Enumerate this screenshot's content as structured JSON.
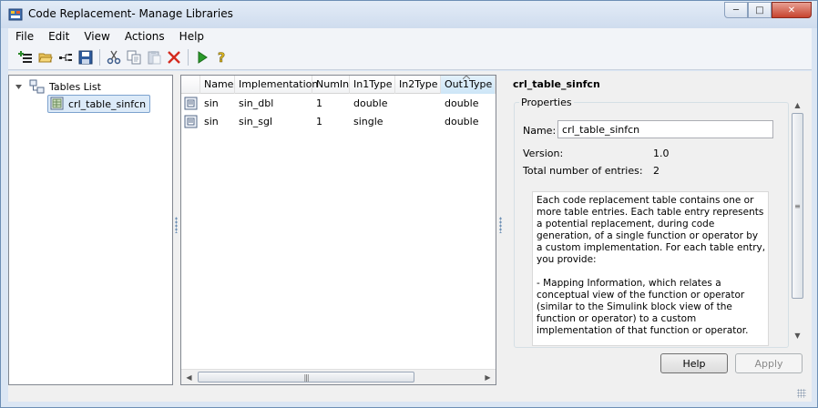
{
  "window": {
    "title": "Code Replacement- Manage Libraries"
  },
  "menu": [
    "File",
    "Edit",
    "View",
    "Actions",
    "Help"
  ],
  "toolbar": {
    "icons": [
      "new-table-icon",
      "open-folder-icon",
      "new-entry-icon",
      "save-icon",
      "cut-icon",
      "copy-icon",
      "paste-icon",
      "delete-icon",
      "validate-run-icon",
      "help-icon"
    ]
  },
  "tree": {
    "root_label": "Tables List",
    "child_label": "crl_table_sinfcn"
  },
  "table": {
    "columns": [
      "Name",
      "Implementation",
      "NumIn",
      "In1Type",
      "In2Type",
      "Out1Type"
    ],
    "rows": [
      [
        "sin",
        "sin_dbl",
        "1",
        "double",
        "",
        "double"
      ],
      [
        "sin",
        "sin_sgl",
        "1",
        "single",
        "",
        "double"
      ]
    ]
  },
  "details": {
    "title": "crl_table_sinfcn",
    "group_label": "Properties",
    "name_label": "Name:",
    "name_value": "crl_table_sinfcn",
    "version_label": "Version:",
    "version_value": "1.0",
    "entries_label": "Total number of entries:",
    "entries_value": "2",
    "description": "Each code replacement table contains one or more table entries. Each table entry represents a potential replacement, during code generation, of a single function or operator by a custom implementation. For each table entry, you provide:\n\n- Mapping Information, which relates a conceptual view of the function or operator (similar to the Simulink block view of the function or operator) to a custom implementation of that function or operator.\n\n- Build Information, which provides any header, source, or link information required for building the"
  },
  "buttons": {
    "help": "Help",
    "apply": "Apply"
  },
  "colors": {
    "accent": "#3a6ea5",
    "delete": "#d42a1e",
    "run": "#2a9a2a"
  }
}
